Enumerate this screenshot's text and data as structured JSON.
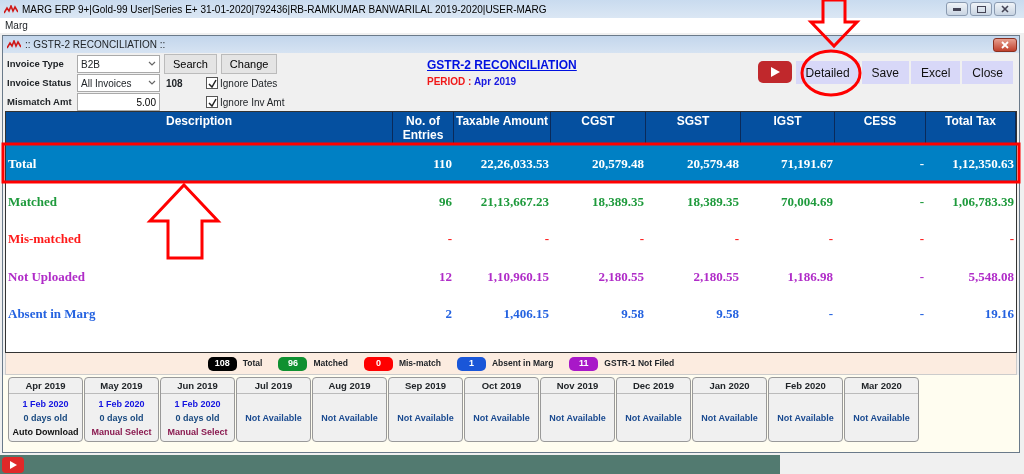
{
  "window": {
    "title": "MARG ERP 9+|Gold-99 User|Series E+ 31-01-2020|792436|RB-RAMKUMAR BANWARILAL 2019-2020|USER-MARG"
  },
  "menu": [
    "Marg"
  ],
  "dialog": {
    "title": ":: GSTR-2 RECONCILIATION ::"
  },
  "filters": {
    "invoice_type": {
      "label": "Invoice Type",
      "value": "B2B"
    },
    "invoice_status": {
      "label": "Invoice Status",
      "value": "All Invoices"
    },
    "count": "108",
    "mismatch_amt": {
      "label": "Mismatch Amt",
      "value": "5.00"
    },
    "buttons": [
      "Search",
      "Change"
    ],
    "checkboxes": [
      {
        "label": "Ignore Dates",
        "checked": true
      },
      {
        "label": "Ignore Inv Amt",
        "checked": true
      }
    ]
  },
  "report": {
    "title": "GSTR-2 RECONCILIATION",
    "period_label": "PERIOD :",
    "period": "Apr 2019"
  },
  "actions": [
    "Detailed",
    "Save",
    "Excel",
    "Close"
  ],
  "table": {
    "columns": [
      "Description",
      "No. of Entries",
      "Taxable Amount",
      "CGST",
      "SGST",
      "IGST",
      "CESS",
      "Total Tax"
    ],
    "rows": [
      {
        "selected": true,
        "cells": [
          "Total",
          "110",
          "22,26,033.53",
          "20,579.48",
          "20,579.48",
          "71,191.67",
          "-",
          "1,12,350.63"
        ]
      },
      {
        "selected": false,
        "color": "#1e9a3c",
        "cells": [
          "Matched",
          "96",
          "21,13,667.23",
          "18,389.35",
          "18,389.35",
          "70,004.69",
          "-",
          "1,06,783.39"
        ]
      },
      {
        "selected": false,
        "color": "#ff1a1a",
        "cells": [
          "Mis-matched",
          "-",
          "-",
          "-",
          "-",
          "-",
          "-",
          "-"
        ]
      },
      {
        "selected": false,
        "color": "#b02cc8",
        "cells": [
          "Not Uploaded",
          "12",
          "1,10,960.15",
          "2,180.55",
          "2,180.55",
          "1,186.98",
          "-",
          "5,548.08"
        ]
      },
      {
        "selected": false,
        "color": "#2462e0",
        "cells": [
          "Absent in Marg",
          "2",
          "1,406.15",
          "9.58",
          "9.58",
          "-",
          "-",
          "19.16"
        ]
      }
    ]
  },
  "legend": [
    {
      "count": "108",
      "label": "Total",
      "color": "#000000"
    },
    {
      "count": "96",
      "label": "Matched",
      "color": "#109030"
    },
    {
      "count": "0",
      "label": "Mis-match",
      "color": "#ff0000"
    },
    {
      "count": "1",
      "label": "Absent in Marg",
      "color": "#1a56d8"
    },
    {
      "count": "11",
      "label": "GSTR-1 Not Filed",
      "color": "#a818c8"
    }
  ],
  "months": [
    {
      "kind": "downloaded",
      "month": "Apr 2019",
      "date": "1 Feb 2020",
      "age": "0 days old",
      "source": "Auto Download",
      "color": "#111111"
    },
    {
      "kind": "downloaded",
      "month": "May 2019",
      "date": "1 Feb 2020",
      "age": "0 days old",
      "source": "Manual Select",
      "color": "#8a1a50"
    },
    {
      "kind": "downloaded",
      "month": "Jun 2019",
      "date": "1 Feb 2020",
      "age": "0 days old",
      "source": "Manual Select",
      "color": "#8a1a50"
    },
    {
      "kind": "unavailable",
      "month": "Jul 2019",
      "status": "Not Available"
    },
    {
      "kind": "unavailable",
      "month": "Aug 2019",
      "status": "Not Available"
    },
    {
      "kind": "unavailable",
      "month": "Sep 2019",
      "status": "Not Available"
    },
    {
      "kind": "unavailable",
      "month": "Oct 2019",
      "status": "Not Available"
    },
    {
      "kind": "unavailable",
      "month": "Nov 2019",
      "status": "Not Available"
    },
    {
      "kind": "unavailable",
      "month": "Dec 2019",
      "status": "Not Available"
    },
    {
      "kind": "unavailable",
      "month": "Jan 2020",
      "status": "Not Available"
    },
    {
      "kind": "unavailable",
      "month": "Feb 2020",
      "status": "Not Available"
    },
    {
      "kind": "unavailable",
      "month": "Mar 2020",
      "status": "Not Available"
    }
  ]
}
